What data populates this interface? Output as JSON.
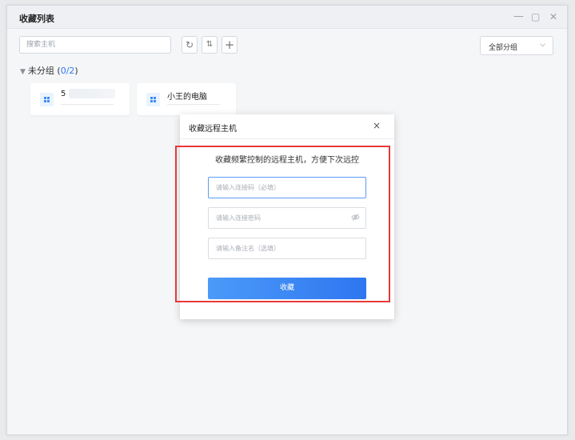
{
  "window": {
    "title": "收藏列表",
    "controls": {
      "minimize": "—",
      "maximize": "▢",
      "close": "✕"
    }
  },
  "toolbar": {
    "search_placeholder": "搜索主机",
    "refresh_icon": "↻",
    "sort_icon": "⇅",
    "add_icon": "+",
    "group_select": "全部分组",
    "chevron": "⌵"
  },
  "group": {
    "triangle": "▼",
    "name": "未分组",
    "count_open": "(",
    "count": "0/2",
    "count_close": ")"
  },
  "hosts": [
    {
      "name": "5",
      "icon": "windows-icon"
    },
    {
      "name": "小王的电脑",
      "icon": "windows-icon"
    }
  ],
  "dialog": {
    "title": "收藏远程主机",
    "close": "×",
    "description": "收藏频繁控制的远程主机，方便下次远控",
    "fields": {
      "connection_code": "请输入连接码（必填）",
      "password": "请输入连接密码",
      "alias": "请输入备注名（选填）"
    },
    "submit": "收藏"
  },
  "colors": {
    "accent": "#2f7bf5",
    "highlight": "#e53a3a"
  }
}
